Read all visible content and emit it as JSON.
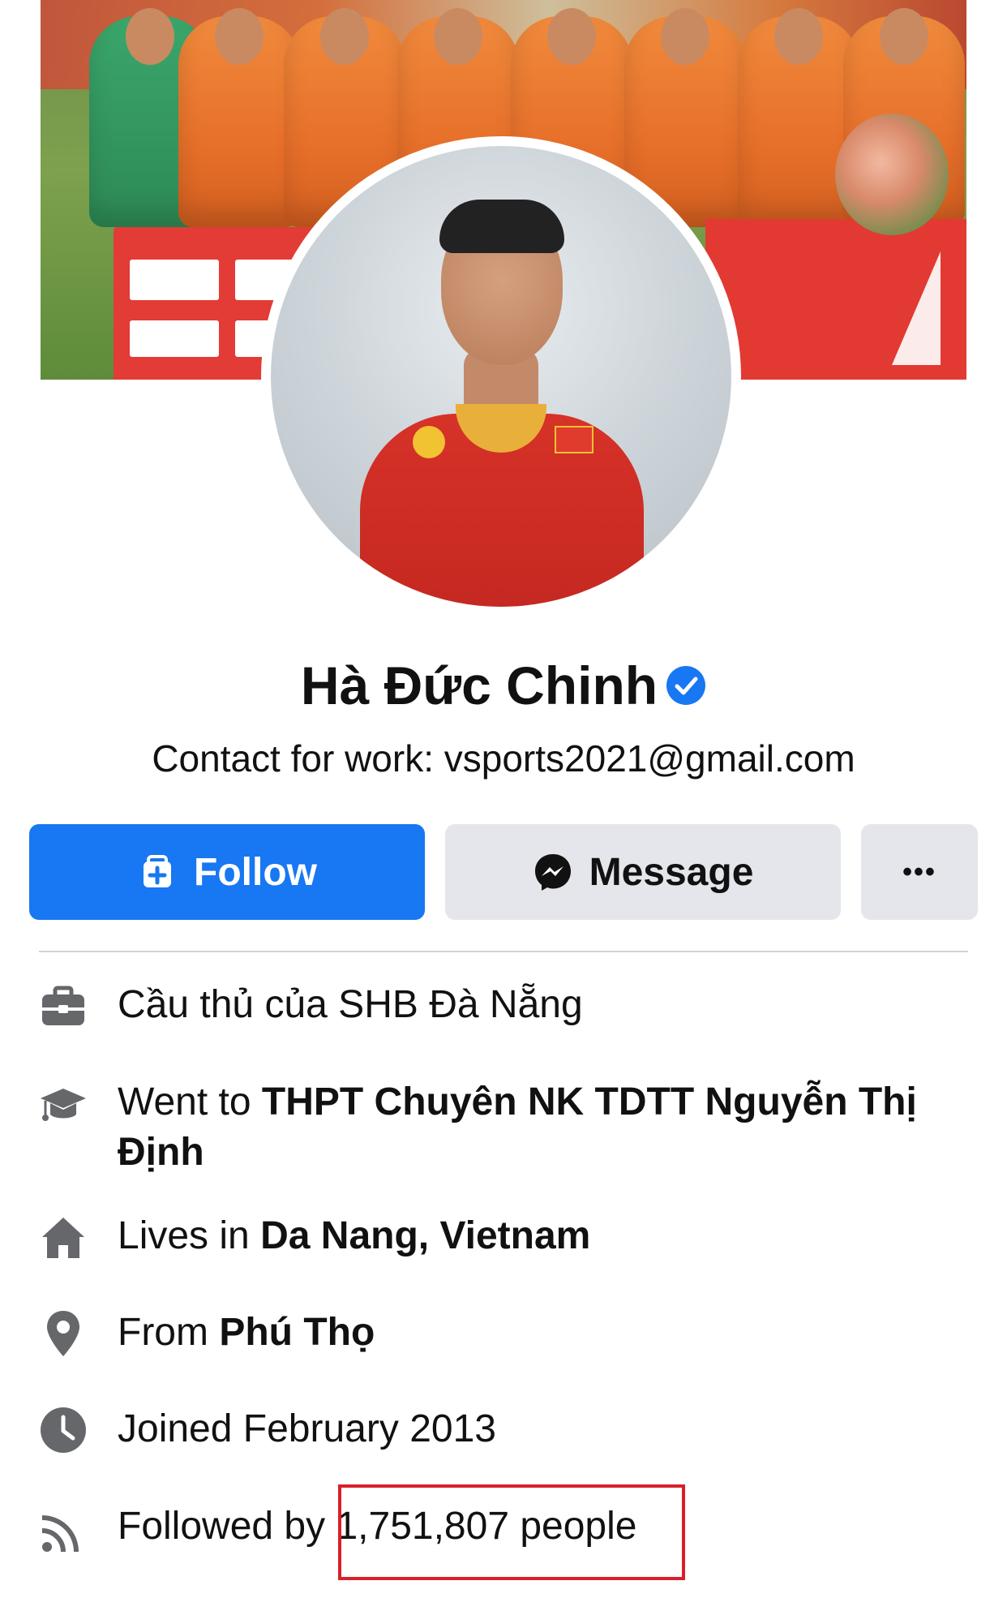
{
  "profile": {
    "name": "Hà Đức Chinh",
    "bio": "Contact for work: vsports2021@gmail.com"
  },
  "actions": {
    "follow_label": "Follow",
    "message_label": "Message",
    "more_label": "•••"
  },
  "info": [
    {
      "icon": "briefcase-icon",
      "prefix": "Cầu thủ của SHB Đà Nẵng",
      "bold": ""
    },
    {
      "icon": "graduation-cap-icon",
      "prefix": "Went to ",
      "bold": "THPT Chuyên NK TDTT Nguyễn Thị Định"
    },
    {
      "icon": "home-icon",
      "prefix": "Lives in ",
      "bold": "Da Nang, Vietnam"
    },
    {
      "icon": "location-pin-icon",
      "prefix": "From ",
      "bold": "Phú Thọ"
    },
    {
      "icon": "clock-icon",
      "prefix": "Joined February 2013",
      "bold": ""
    },
    {
      "icon": "rss-feed-icon",
      "prefix": "Followed by ",
      "bold": "",
      "suffix": "1,751,807 people"
    }
  ],
  "colors": {
    "accent": "#1877f2",
    "highlight": "#d9202a",
    "secondary_button": "#e4e6eb"
  }
}
